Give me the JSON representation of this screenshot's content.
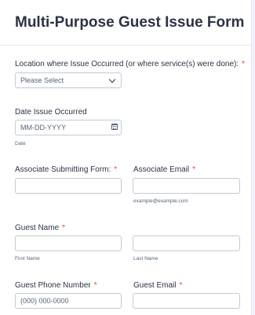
{
  "form": {
    "title": "Multi-Purpose Guest Issue Form"
  },
  "location": {
    "label": "Location where Issue Occurred (or where service(s) were done):",
    "required_mark": "*",
    "selected_value": "Please Select"
  },
  "date_issue": {
    "label": "Date Issue Occurred",
    "placeholder": "MM-DD-YYYY",
    "sublabel": "Date",
    "icon": "calendar-icon"
  },
  "associate_submitting": {
    "label": "Associate Submitting Form:",
    "required_mark": "*",
    "value": ""
  },
  "associate_email": {
    "label": "Associate Email",
    "required_mark": "*",
    "value": "",
    "sublabel": "example@example.com"
  },
  "guest_name": {
    "label": "Guest Name",
    "required_mark": "*",
    "first_sublabel": "First Name",
    "last_sublabel": "Last Name"
  },
  "guest_phone": {
    "label": "Guest Phone Number",
    "required_mark": "*",
    "placeholder": "(000) 000-0000"
  },
  "guest_email": {
    "label": "Guest Email",
    "required_mark": "*",
    "value": ""
  },
  "colors": {
    "required": "#f23a3c",
    "text": "#2c3345",
    "border": "#c3cad8",
    "background": "#f3f3fe"
  }
}
